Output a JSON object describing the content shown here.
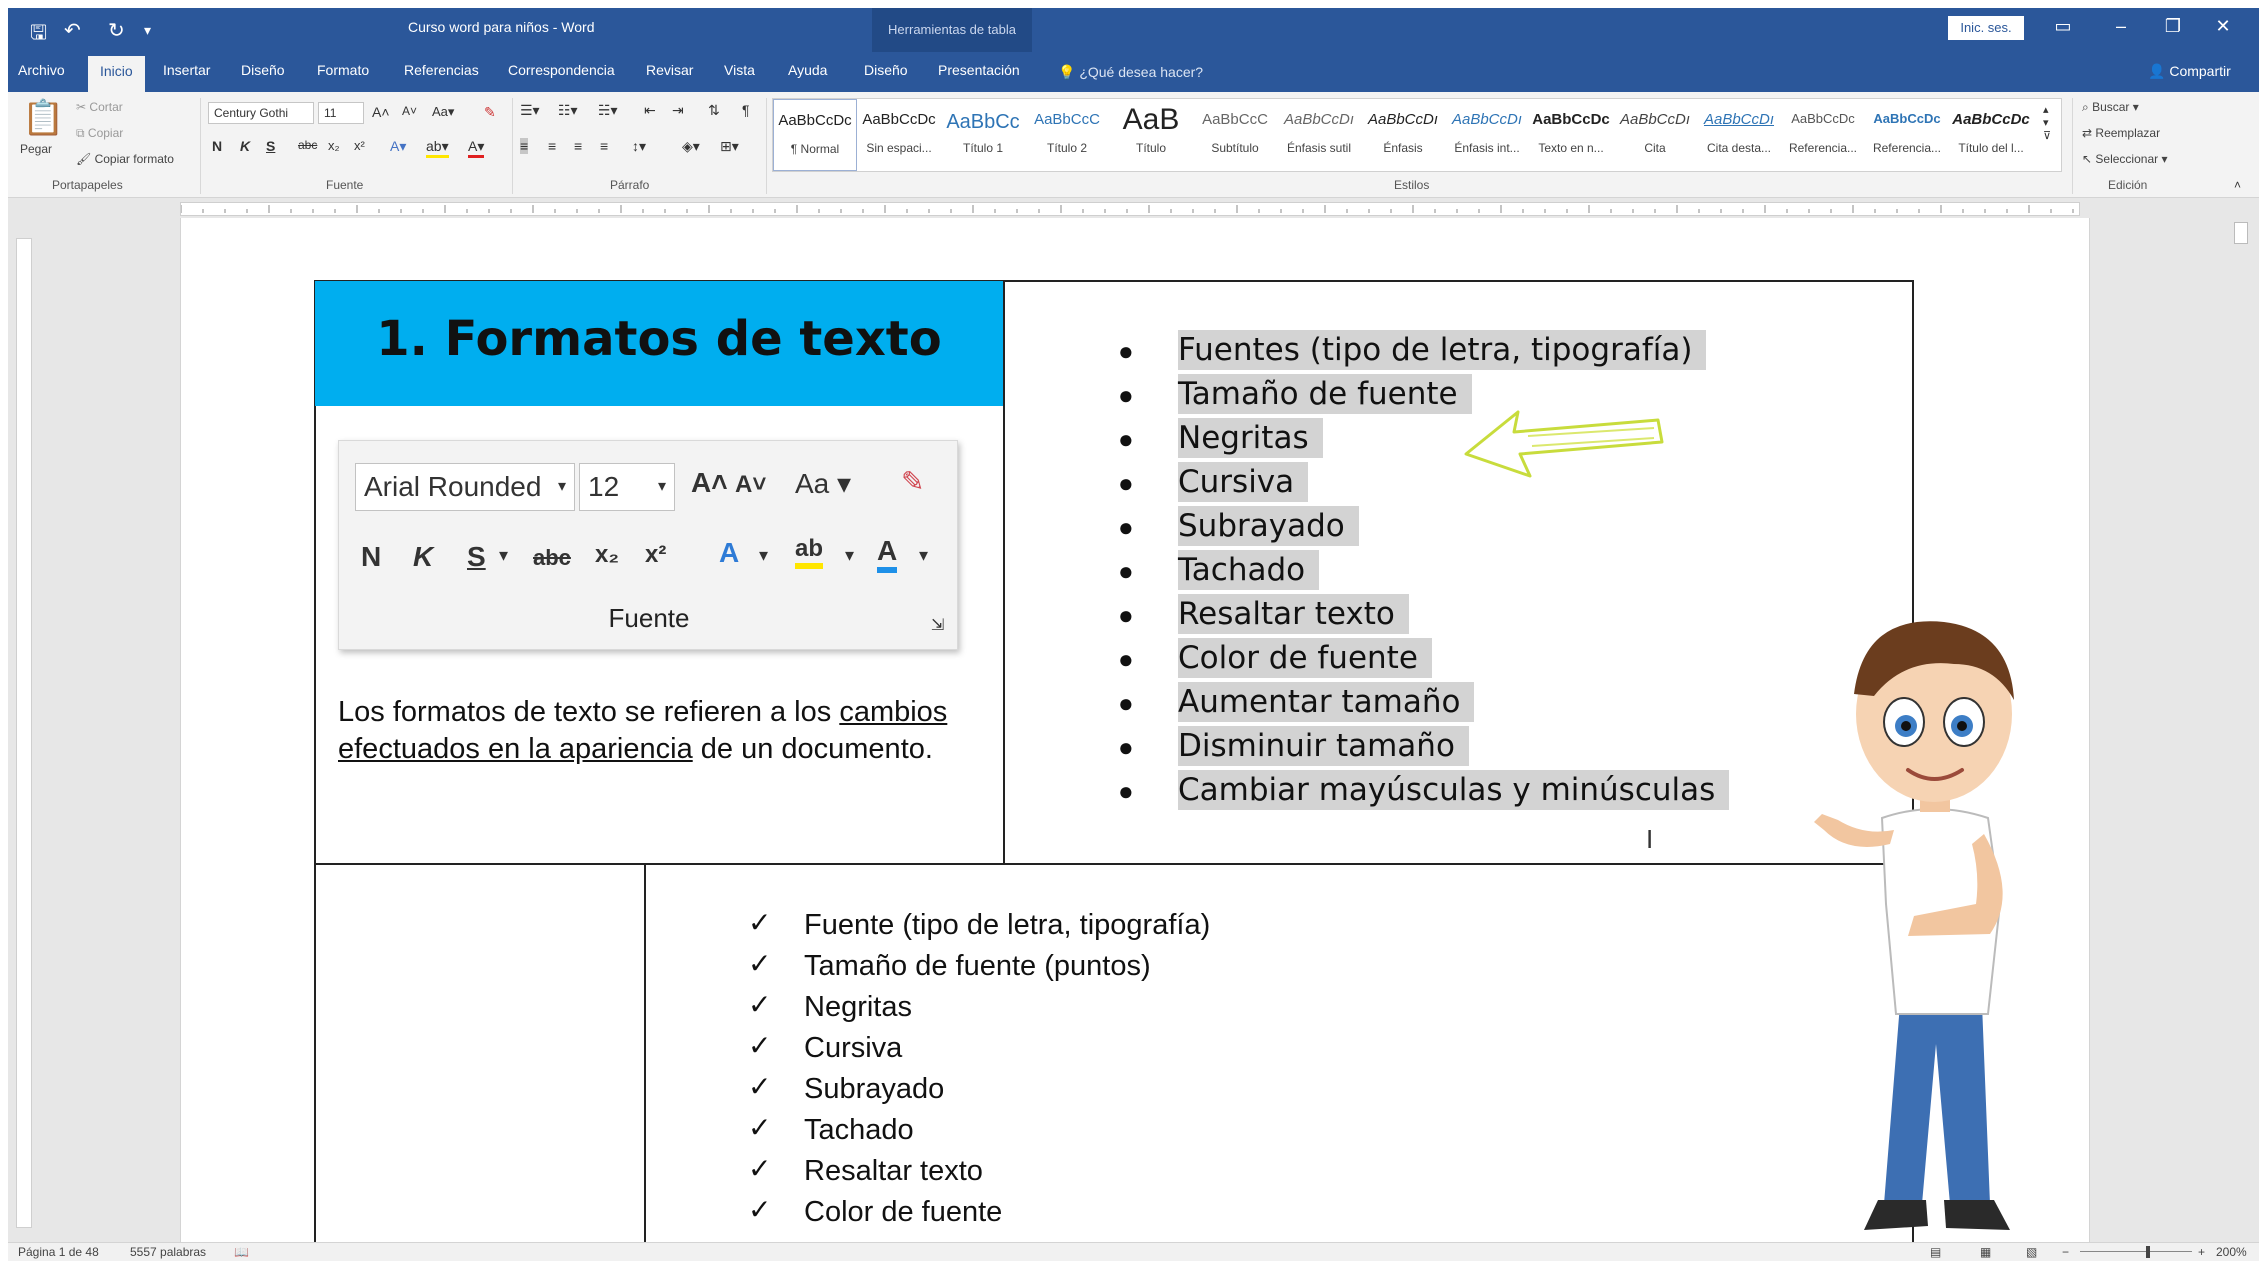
{
  "window": {
    "doc_title": "Curso word para niños  -  Word",
    "context_title": "Herramientas de tabla",
    "sign_in": "Inic. ses.",
    "share": "Compartir"
  },
  "tabs": [
    "Archivo",
    "Inicio",
    "Insertar",
    "Diseño",
    "Formato",
    "Referencias",
    "Correspondencia",
    "Revisar",
    "Vista",
    "Ayuda",
    "Diseño",
    "Presentación"
  ],
  "tell_me": "¿Qué desea hacer?",
  "ribbon": {
    "clipboard": {
      "paste": "Pegar",
      "cut": "Cortar",
      "copy": "Copiar",
      "format_painter": "Copiar formato",
      "label": "Portapapeles"
    },
    "font": {
      "name": "Century Gothi",
      "size": "11",
      "label": "Fuente"
    },
    "paragraph": {
      "label": "Párrafo"
    },
    "styles": {
      "label": "Estilos",
      "items": [
        {
          "preview": "AaBbCcDc",
          "name": "¶ Normal"
        },
        {
          "preview": "AaBbCcDc",
          "name": "Sin espaci..."
        },
        {
          "preview": "AaBbCc",
          "name": "Título 1"
        },
        {
          "preview": "AaBbCcC",
          "name": "Título 2"
        },
        {
          "preview": "AaB",
          "name": "Título"
        },
        {
          "preview": "AaBbCcC",
          "name": "Subtítulo"
        },
        {
          "preview": "AaBbCcDı",
          "name": "Énfasis sutil"
        },
        {
          "preview": "AaBbCcDı",
          "name": "Énfasis"
        },
        {
          "preview": "AaBbCcDı",
          "name": "Énfasis int..."
        },
        {
          "preview": "AaBbCcDc",
          "name": "Texto en n..."
        },
        {
          "preview": "AaBbCcDı",
          "name": "Cita"
        },
        {
          "preview": "AaBbCcDı",
          "name": "Cita desta..."
        },
        {
          "preview": "AaBbCcDc",
          "name": "Referencia..."
        },
        {
          "preview": "AaBbCcDc",
          "name": "Referencia..."
        },
        {
          "preview": "AaBbCcDc",
          "name": "Título del l..."
        }
      ]
    },
    "editing": {
      "find": "Buscar",
      "replace": "Reemplazar",
      "select": "Seleccionar",
      "label": "Edición"
    }
  },
  "document": {
    "section_title": "1.  Formatos de texto",
    "font_panel": {
      "font": "Arial Rounded",
      "size": "12",
      "label": "Fuente"
    },
    "intro": {
      "before": "Los formatos de texto se refieren a los ",
      "underlined": "cambios efectuados en la apariencia",
      "after": " de un documento."
    },
    "bullets": [
      "Fuentes (tipo de letra, tipografía)",
      "Tamaño de fuente",
      "Negritas",
      "Cursiva",
      "Subrayado",
      "Tachado",
      "Resaltar texto",
      "Color de fuente",
      "Aumentar tamaño",
      "Disminuir tamaño",
      "Cambiar mayúsculas y minúsculas"
    ],
    "checks": [
      "Fuente (tipo de letra, tipografía)",
      "Tamaño de fuente (puntos)",
      "Negritas",
      "Cursiva",
      "Subrayado",
      "Tachado",
      "Resaltar texto",
      "Color de fuente"
    ]
  },
  "status": {
    "page": "Página 1 de 48",
    "words": "5557 palabras",
    "zoom": "200%"
  },
  "colors": {
    "ribbon_blue": "#2b579a",
    "banner": "#00aeef",
    "highlight": "#d3d3d3",
    "arrow": "#c8dc3c"
  }
}
